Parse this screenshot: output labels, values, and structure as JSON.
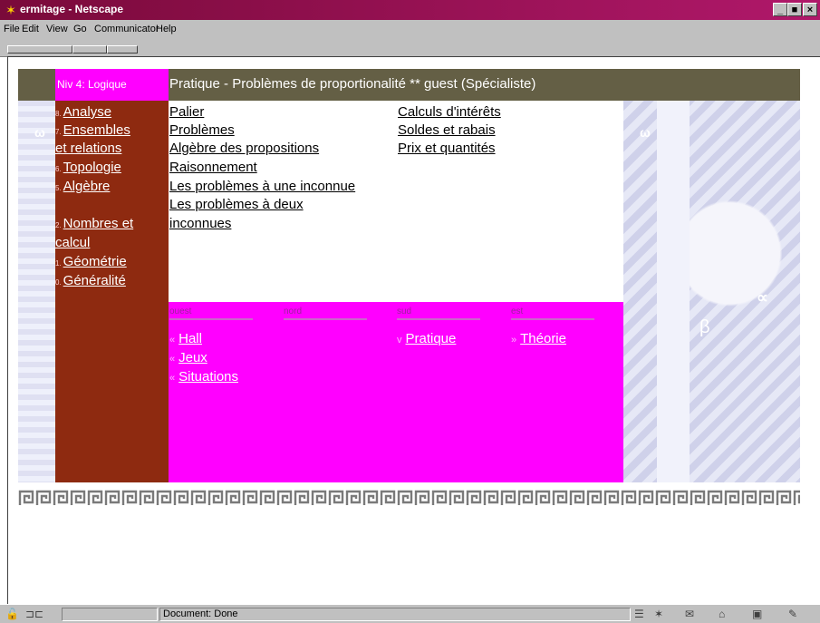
{
  "window": {
    "title": "ermitage - Netscape",
    "minimize": "_",
    "maximize": "■",
    "close": "×"
  },
  "menu": [
    "File",
    "Edit",
    "View",
    "Go",
    "Communicator",
    "Help"
  ],
  "header": {
    "level": "Niv 4: Logique",
    "title": "Pratique - Problèmes de proportionalité ** guest (Spécialiste)"
  },
  "sidebar": {
    "items": [
      {
        "num": "8.",
        "label": "Analyse"
      },
      {
        "num": "7.",
        "label": "Ensembles"
      },
      {
        "num": "",
        "label": "et relations"
      },
      {
        "num": "6.",
        "label": "Topologie"
      },
      {
        "num": "5.",
        "label": "Algèbre"
      },
      {
        "num": "2.",
        "label": "Nombres et"
      },
      {
        "num": "",
        "label": "calcul"
      },
      {
        "num": "1.",
        "label": "Géométrie"
      },
      {
        "num": "0.",
        "label": "Généralité"
      }
    ]
  },
  "content": {
    "col1": [
      "Palier",
      "Problèmes",
      "Algèbre des propositions",
      "Raisonnement",
      "Les problèmes à une inconnue",
      "Les problèmes à deux",
      "inconnues"
    ],
    "col2": [
      "Calculs d'intérêts",
      "Soldes et rabais",
      "Prix et quantités"
    ]
  },
  "directions": {
    "ouest": {
      "head": "ouest",
      "links": [
        {
          "mark": "«",
          "label": "Hall"
        },
        {
          "mark": "«",
          "label": "Jeux"
        },
        {
          "mark": "«",
          "label": "Situations"
        }
      ]
    },
    "nord": {
      "head": "nord"
    },
    "sud": {
      "head": "sud",
      "links": [
        {
          "mark": "v",
          "label": "Pratique"
        }
      ]
    },
    "est": {
      "head": "est",
      "links": [
        {
          "mark": "»",
          "label": "Théorie"
        }
      ]
    }
  },
  "decor": {
    "greek_left": "ω",
    "greek_right": "ω",
    "alpha": "∝",
    "beta": "β"
  },
  "status": {
    "text": "Document: Done"
  },
  "colors": {
    "magenta": "#ff00ff",
    "brown": "#8e2a10",
    "olive": "#645f45"
  }
}
